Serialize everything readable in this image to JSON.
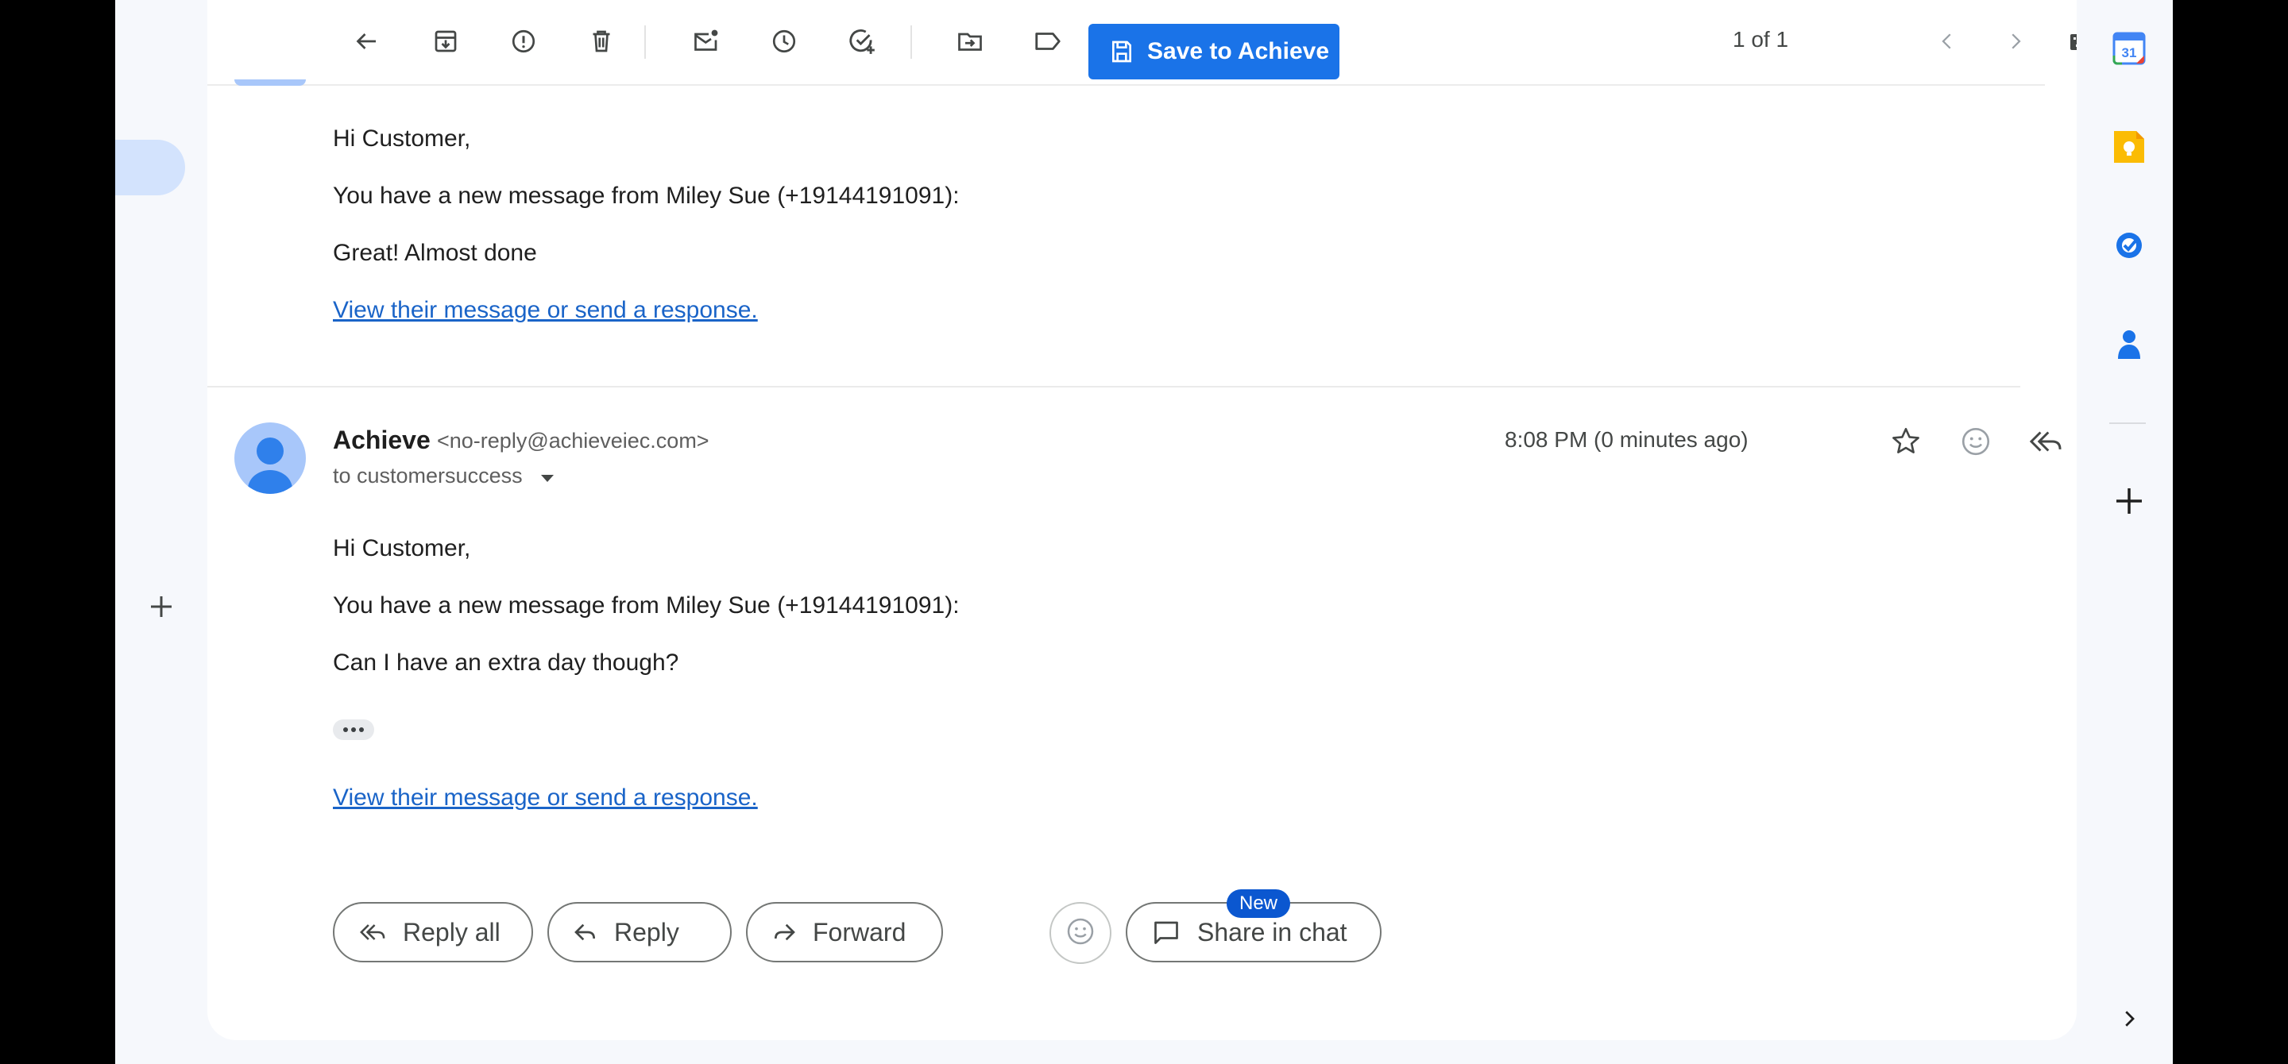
{
  "toolbar": {
    "icons": [
      "back-arrow-icon",
      "archive-icon",
      "report-spam-icon",
      "delete-icon",
      "mark-unread-icon",
      "snooze-icon",
      "add-to-tasks-icon",
      "move-to-icon",
      "label-icon",
      "more-vert-icon"
    ],
    "save_button_label": "Save to Achieve",
    "pager_text": "1 of 1",
    "input_tools": "keyboard-icon"
  },
  "previous_message": {
    "greeting": "Hi Customer,",
    "intro": "You have a new message from Miley Sue (+19144191091):",
    "message": "Great! Almost done",
    "link": "View their message or send a response."
  },
  "message": {
    "sender_name": "Achieve",
    "sender_email": "<no-reply@achieveiec.com>",
    "to_line": "to customersuccess",
    "time": "8:08 PM (0 minutes ago)",
    "greeting": "Hi Customer,",
    "intro": "You have a new message from Miley Sue (+19144191091):",
    "message": "Can I have an extra day though?",
    "link": "View their message or send a response."
  },
  "actions": {
    "reply_all": "Reply all",
    "reply": "Reply",
    "forward": "Forward",
    "share_in_chat": "Share in chat",
    "new_badge": "New"
  },
  "side_panel": {
    "calendar_date": "31",
    "apps": [
      "calendar-icon",
      "keep-icon",
      "tasks-icon",
      "contacts-icon",
      "add-icon",
      "expand-icon"
    ]
  },
  "colors": {
    "accent": "#1a73e8",
    "link": "#1a64c8",
    "background": "#f6f8fc"
  }
}
